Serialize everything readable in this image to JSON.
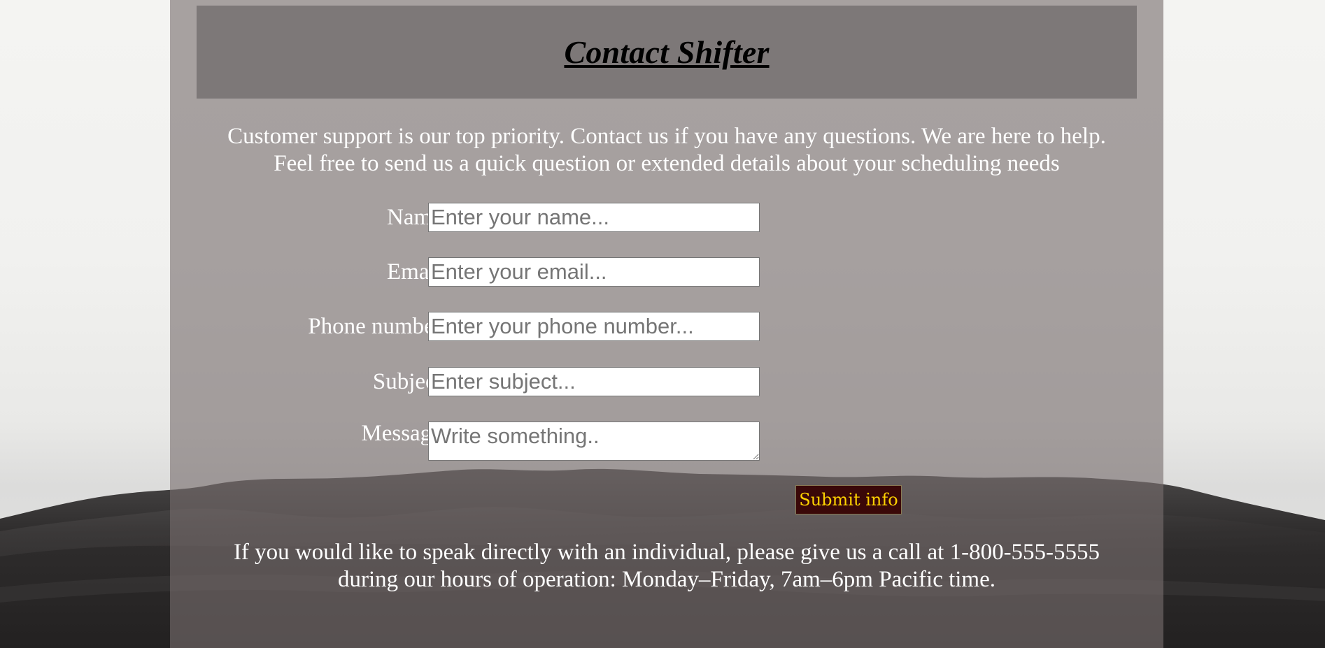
{
  "header": {
    "title": "Contact Shifter"
  },
  "intro": {
    "line1": "Customer support is our top priority. Contact us if you have any questions. We are here to help.",
    "line2": "Feel free to send us a quick question or extended details about your scheduling needs"
  },
  "form": {
    "name": {
      "label": "Name:",
      "placeholder": "Enter your name..."
    },
    "email": {
      "label": "Email:",
      "placeholder": "Enter your email..."
    },
    "phone": {
      "label": "Phone number:",
      "placeholder": "Enter your phone number..."
    },
    "subject": {
      "label": "Subject:",
      "placeholder": "Enter subject..."
    },
    "message": {
      "label": "Message:",
      "placeholder": "Write something.."
    },
    "submit_label": "Submit info"
  },
  "footer": {
    "line1": "If you would like to speak directly with an individual, please give us a call at 1-800-555-5555",
    "line2": "during our hours of operation: Monday–Friday, 7am–6pm Pacific time."
  },
  "colors": {
    "panel": "#786e6e",
    "header_box": "#7d7878",
    "submit_bg": "#3a0808",
    "submit_text": "#ffd200",
    "mountain": "#2e2c2c"
  }
}
